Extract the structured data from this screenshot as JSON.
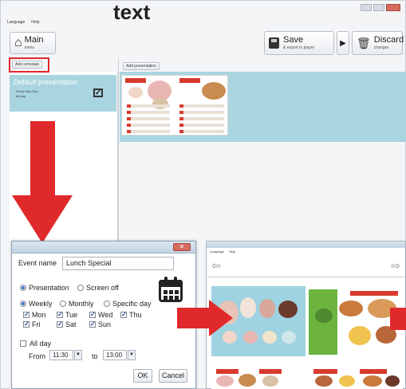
{
  "overlay_text": "text",
  "menubar": {
    "items": [
      "Language",
      "Help"
    ]
  },
  "toolbar": {
    "main_label": "Main",
    "main_sub": "menu",
    "save_label": "Save",
    "save_sub": "& export to player",
    "discard_label": "Discard",
    "discard_sub": "changes"
  },
  "left": {
    "add_schedule": "Add schedule",
    "presentation_title": "Default presentation",
    "days": "Every Mon-Sun",
    "time": "All day"
  },
  "right": {
    "add_presentation": "Add presentation"
  },
  "dialog": {
    "event_name_label": "Event name",
    "event_name_value": "Lunch Special",
    "presentation_label": "Presentation",
    "screen_off_label": "Screen off",
    "weekly_label": "Weekly",
    "monthly_label": "Monthly",
    "specific_day_label": "Specific day",
    "days": [
      "Mon",
      "Tue",
      "Wed",
      "Thu",
      "Fri",
      "Sat",
      "Sun"
    ],
    "all_day_label": "All day",
    "from_label": "From",
    "from_value": "11:30",
    "to_label": "to",
    "to_value": "13:00",
    "ok_label": "OK",
    "cancel_label": "Cancel"
  },
  "player": {
    "menu": [
      "Language",
      "Help"
    ]
  },
  "colors": {
    "accent_red": "#e0292b",
    "schedule_blue": "#a9d5e0",
    "menu_red": "#d83a2e"
  }
}
